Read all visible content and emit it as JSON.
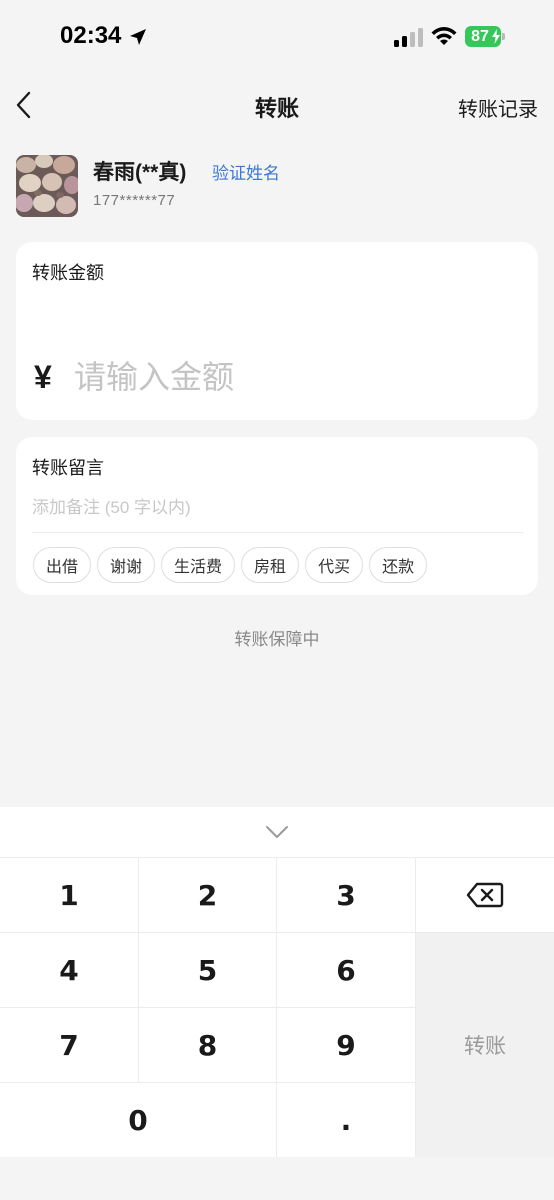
{
  "status_bar": {
    "time": "02:34",
    "battery": "87",
    "icons": [
      "location-arrow-icon",
      "signal-icon",
      "wifi-icon",
      "battery-charging-icon"
    ]
  },
  "nav": {
    "back_icon": "chevron-left-icon",
    "title": "转账",
    "history_label": "转账记录"
  },
  "recipient": {
    "name": "春雨(**真)",
    "verify_label": "验证姓名",
    "phone": "177******77"
  },
  "amount_card": {
    "label": "转账金额",
    "currency": "¥",
    "placeholder": "请输入金额",
    "value": ""
  },
  "memo_card": {
    "label": "转账留言",
    "placeholder": "添加备注 (50 字以内)",
    "value": "",
    "chips": [
      "出借",
      "谢谢",
      "生活费",
      "房租",
      "代买",
      "还款"
    ]
  },
  "guarantee_text": "转账保障中",
  "keypad": {
    "collapse_icon": "chevron-down-icon",
    "digits": [
      "1",
      "2",
      "3",
      "4",
      "5",
      "6",
      "7",
      "8",
      "9",
      "0",
      "."
    ],
    "delete_icon": "backspace-icon",
    "submit_label": "转账"
  },
  "colors": {
    "background": "#f4f4f4",
    "card": "#ffffff",
    "link": "#3a78d6",
    "battery": "#34c759",
    "submit_bg": "#f1f1f1",
    "submit_text": "#9a9a9a"
  }
}
